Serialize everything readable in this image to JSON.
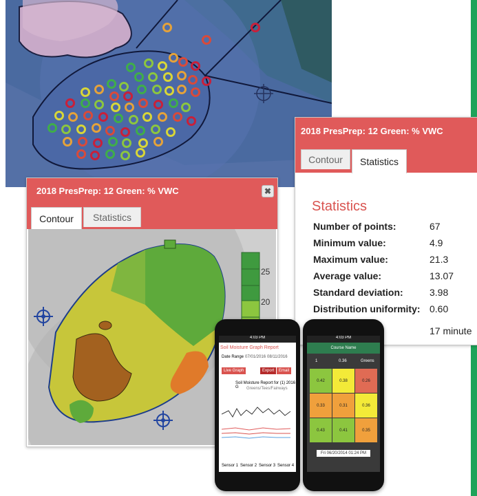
{
  "stats_panel": {
    "title": "2018 PresPrep: 12 Green: % VWC",
    "tabs": [
      "Contour",
      "Statistics"
    ],
    "heading": "Statistics",
    "rows": [
      {
        "label": "Number of points:",
        "value": "67"
      },
      {
        "label": "Minimum value:",
        "value": "4.9"
      },
      {
        "label": "Maximum value:",
        "value": "21.3"
      },
      {
        "label": "Average value:",
        "value": "13.07"
      },
      {
        "label": "Standard deviation:",
        "value": "3.98"
      },
      {
        "label": "Distribution uniformity:",
        "value": "0.60"
      }
    ],
    "extra": "17 minute"
  },
  "contour_panel": {
    "title": "2018 PresPrep: 12 Green: % VWC",
    "close": "✖",
    "tabs": [
      "Contour",
      "Statistics"
    ],
    "legend_ticks": [
      "25",
      "20"
    ]
  },
  "phone_left": {
    "status_time": "4:03 PM",
    "title": "Soil Moisture Graph Report",
    "date_label": "Date Range",
    "date_from": "07/01/2016",
    "date_to": "08/11/2016",
    "btn_left": "Live Graph",
    "btn_right_a": "Export",
    "btn_right_b": "Email",
    "chart_title": "Soil Moisture Report for (1) 2016 G",
    "chart_subtitle": "Greens/Tees/Fairways",
    "legend": [
      "Sensor 1",
      "Sensor 2",
      "Sensor 3",
      "Sensor 4"
    ]
  },
  "phone_right": {
    "status_time": "4:03 PM",
    "header": "Course Name",
    "row_a": [
      "1",
      "0.36",
      "Greens"
    ],
    "grid": [
      [
        "0.42",
        "0.38",
        "0.26"
      ],
      [
        "0.33",
        "0.31",
        "0.36"
      ],
      [
        "0.43",
        "0.41",
        "0.35"
      ]
    ],
    "grid_colors": [
      [
        "#8cc63f",
        "#f3ea38",
        "#e06b54"
      ],
      [
        "#f0a03c",
        "#f0a03c",
        "#f3ea38"
      ],
      [
        "#8cc63f",
        "#8cc63f",
        "#f0a03c"
      ]
    ],
    "date_bar": "Fri 06/20/2014 01:24 PM"
  }
}
